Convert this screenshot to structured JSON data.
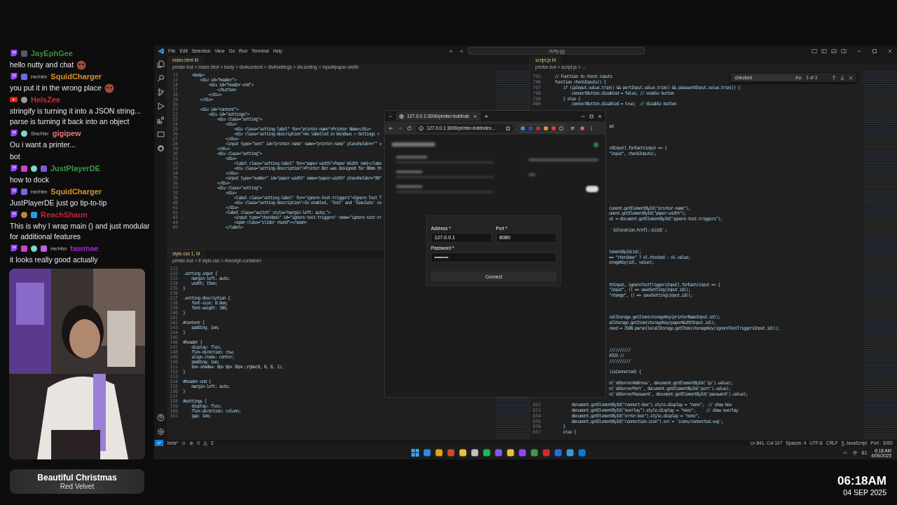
{
  "chat": [
    {
      "kind": "twitch",
      "badges": [
        {
          "kind": "screen"
        }
      ],
      "name": "JayEphGee",
      "color": "#3f8a3f",
      "lines": [
        {
          "text": "hello nutty and chat",
          "emote": true
        }
      ]
    },
    {
      "kind": "twitch",
      "badges": [
        {
          "kind": "flower"
        }
      ],
      "pronoun": "He/Him",
      "name": "SquidCharger",
      "color": "#d9902a",
      "lines": [
        {
          "text": "you put it in the wrong place",
          "emote": true
        }
      ]
    },
    {
      "kind": "youtube",
      "badges": [
        {
          "kind": "verified"
        }
      ],
      "name": "HelsZee",
      "color": "#d42a2a",
      "lines": [
        {
          "text": "stringify is turning it into a JSON string... parse is turning it back into an object",
          "emote": false
        }
      ]
    },
    {
      "kind": "twitch",
      "badges": [
        {
          "kind": "shield"
        }
      ],
      "pronoun": "She/Her",
      "name": "gigipew",
      "color": "#e8737a",
      "lines": [
        {
          "text": "Ou i want a printer...",
          "emote": false
        },
        {
          "text": "bot",
          "emote": false
        }
      ]
    },
    {
      "kind": "twitch",
      "badges": [
        {
          "kind": "gem"
        },
        {
          "kind": "shield"
        },
        {
          "kind": "bars"
        }
      ],
      "name": "JustPlayerDE",
      "color": "#3c9a4a",
      "lines": [
        {
          "text": "how to dock",
          "emote": false
        }
      ]
    },
    {
      "kind": "twitch",
      "badges": [
        {
          "kind": "flower"
        }
      ],
      "pronoun": "He/Him",
      "name": "SquidCharger",
      "color": "#d9902a",
      "lines": [
        {
          "text": "JustPlayerDE just go tip-to-tip",
          "emote": false
        }
      ]
    },
    {
      "kind": "twitch",
      "badges": [
        {
          "kind": "acorn"
        },
        {
          "kind": "crown"
        }
      ],
      "name": "ReachShaun",
      "color": "#c0243c",
      "lines": [
        {
          "text": "This is why I wrap main () and just modular for additional features",
          "emote": false
        }
      ]
    },
    {
      "kind": "twitch",
      "badges": [
        {
          "kind": "gem"
        },
        {
          "kind": "shield"
        },
        {
          "kind": "heart"
        }
      ],
      "pronoun": "He/Him",
      "name": "tawmae",
      "color": "#9a28c8",
      "lines": [
        {
          "text": "it looks really good actually",
          "emote": false
        }
      ]
    }
  ],
  "now_playing": {
    "title": "Beautiful Christmas",
    "artist": "Red Velvet"
  },
  "clock": {
    "time": "06:18AM",
    "date": "04 SEP 2025"
  },
  "vscode": {
    "menu": [
      "File",
      "Edit",
      "Selection",
      "View",
      "Go",
      "Run",
      "Terminal",
      "Help"
    ],
    "search": "nutty.gg",
    "top_pane": {
      "tab": "index.html M",
      "breadcrumb": "printer-bot > index.html > body > div#content > div#settings > div.setting > input#paper-width",
      "lines": [
        {
          "n": "11",
          "text": "    <body>"
        },
        {
          "n": "12",
          "text": "        <div id=\"header\">"
        },
        {
          "n": "14",
          "text": "            <div id=\"header-end\">"
        },
        {
          "n": "17",
          "text": "                </button>"
        },
        {
          "n": "18",
          "text": "            </div>"
        },
        {
          "n": "19",
          "text": "        </div>"
        },
        {
          "n": "20"
        },
        {
          "n": "21",
          "text": "        <div id=\"content\">"
        },
        {
          "n": "22",
          "text": "            <div id=\"settings\">"
        },
        {
          "n": "23",
          "text": "                <div class=\"setting\">"
        },
        {
          "n": "24",
          "text": "                    <div>"
        },
        {
          "n": "25",
          "text": "                        <div class=\"setting-label\" for=\"printer-name\">Printer Name</div>"
        },
        {
          "n": "26",
          "text": "                        <div class=\"setting-description\">As labelled in Windows > Settings >"
        },
        {
          "n": "27",
          "text": "                    </div>"
        },
        {
          "n": "28",
          "text": "                    <input type=\"text\" id=\"printer-name\" name=\"printer-name\" placeholder=\"\" v"
        },
        {
          "n": "29",
          "text": "                </div>"
        },
        {
          "n": "30",
          "text": "                <div class=\"setting\">"
        },
        {
          "n": "31",
          "text": "                    <div>"
        },
        {
          "n": "32",
          "text": "                        <label class=\"setting-label\" for=\"paper-width\">Paper Width (mm)</labe"
        },
        {
          "n": "33",
          "text": "                        <div class=\"setting-description\">Printer Bot was designed for 80mm th"
        },
        {
          "n": "34",
          "text": "                    </div>"
        },
        {
          "n": "35",
          "text": "                    <input type=\"number\" id=\"paper-width\" name=\"paper-width\" placeholder=\"80\""
        },
        {
          "n": "36",
          "text": "                </div>"
        },
        {
          "n": "37",
          "text": "                <div class=\"setting\">"
        },
        {
          "n": "38",
          "text": "                    <div>"
        },
        {
          "n": "39",
          "text": "                        <label class=\"setting-label\" for=\"ignore-test-triggers\">Ignore Test T"
        },
        {
          "n": "40",
          "text": "                        <div class=\"setting-description\">In enabled, 'Test' and 'Simulate' ev"
        },
        {
          "n": "41",
          "text": "                    </div>"
        },
        {
          "n": "42",
          "text": "                    <label class=\"switch\" style=\"margin-left: auto;\">"
        },
        {
          "n": "43",
          "text": "                        <input type=\"checkbox\" id=\"ignore-test-triggers\" name=\"ignore-test-tr"
        },
        {
          "n": "44",
          "text": "                        <span class=\"slider round\"></span>"
        },
        {
          "n": "45",
          "text": "                    </label>"
        }
      ]
    },
    "bottom_pane": {
      "tab": "style.css 1, M",
      "breadcrumb": "printer-bot > # style.css > #receipt-container",
      "lines": [
        {
          "n": "131"
        },
        {
          "n": "132",
          "text": ".setting input {"
        },
        {
          "n": "133",
          "text": "    margin-left: auto;"
        },
        {
          "n": "134",
          "text": "    width: 15em;"
        },
        {
          "n": "135",
          "text": "}"
        },
        {
          "n": "136"
        },
        {
          "n": "137",
          "text": ".setting-description {"
        },
        {
          "n": "138",
          "text": "    font-size: 0.9em;"
        },
        {
          "n": "139",
          "text": "    font-weight: 100;"
        },
        {
          "n": "140",
          "text": "}"
        },
        {
          "n": "141"
        },
        {
          "n": "142",
          "text": "#content {"
        },
        {
          "n": "143",
          "text": "    padding: 1em;"
        },
        {
          "n": "144",
          "text": "}"
        },
        {
          "n": "145"
        },
        {
          "n": "146",
          "text": "#header {"
        },
        {
          "n": "147",
          "text": "    display: flex;"
        },
        {
          "n": "148",
          "text": "    flex-direction: row;"
        },
        {
          "n": "149",
          "text": "    align-items: center;"
        },
        {
          "n": "150",
          "text": "    padding: 1em;"
        },
        {
          "n": "151",
          "text": "    box-shadow: 0px 0px 10px ▢rgba(0, 0, 0, 1);"
        },
        {
          "n": "152",
          "text": "}"
        },
        {
          "n": "153"
        },
        {
          "n": "154",
          "text": "#header-end {"
        },
        {
          "n": "155",
          "text": "    margin-left: auto;"
        },
        {
          "n": "156",
          "text": "}"
        },
        {
          "n": "157"
        },
        {
          "n": "158",
          "text": "#settings {"
        },
        {
          "n": "159",
          "text": "    display: flex;"
        },
        {
          "n": "160",
          "text": "    flex-direction: column;"
        },
        {
          "n": "161",
          "text": "    gap: 1em;"
        }
      ]
    },
    "right_pane": {
      "tab": "script.js M",
      "breadcrumb": "printer-bot > script.js > ...",
      "find": {
        "query": "checked",
        "case": "Aa",
        "count": "3 of 3"
      },
      "top_lines": [
        {
          "n": "795",
          "text": "    // Function to check inputs"
        },
        {
          "n": "796",
          "text": "    function checkInputs() {"
        },
        {
          "n": "797",
          "text": "        if (ipInput.value.trim() && portInput.value.trim() && passwordInput.value.trim()) {"
        },
        {
          "n": "798",
          "text": "            connectButton.disabled = false; // enable button"
        },
        {
          "n": "799",
          "text": "        } else {"
        },
        {
          "n": "800",
          "text": "            connectButton.disabled = true;  // disable button"
        }
      ],
      "fragments": [
        "ad",
        "rdInput].forEach(input => {",
        "\"input\", checkInputs);",
        "cument.getElementById(\"printer-name\");",
        "ument.getElementById(\"paper-width\");",
        "ut = document.getElementById(\"ignore-test-triggers\");",
        " `${location.href}::${id}`;",
        "lementById(id);",
        "== \"checkbox\" ? el.checked : el.value;",
        "orageKey(id), value);",
        "thInput, ignoreTestTriggersInput].forEach(input => {",
        "\"input\", () => saveSetting(input.id));",
        "\"change\", () => saveSetting(input.id));",
        "calStorage.getItem(storageKey(printerNameInput.id));",
        "alStorage.getItem(storageKey(paperWidthInput.id));",
        "cked = JSON.parse(localStorage.getItem(storageKey(ignoreTestTriggersInput.id)));",
        "//////////",
        "ATUS //",
        "//////////",
        "(isConnected) {",
        "n('sbServerAddress', document.getElementById('ip').value);",
        "n('sbServerPort', document.getElementById('port').value);",
        "n('sbServerPassword', document.getElementById('password').value);"
      ],
      "bottom_lines": [
        {
          "n": "852",
          "text": "            document.getElementById(\"connect-box\").style.display = \"none\";  // show box"
        },
        {
          "n": "853",
          "text": "            document.getElementById(\"overlay\").style.display = \"none\";     // show overlay"
        },
        {
          "n": "854",
          "text": "            document.getElementById(\"error-box\").style.display = \"none\";"
        },
        {
          "n": "855",
          "text": "            document.getElementById(\"connection-icon\").src = 'icons/connected.svg';"
        },
        {
          "n": "856",
          "text": "        }"
        },
        {
          "n": "857",
          "text": "        else {"
        }
      ]
    },
    "status_left": {
      "branch": "beta*",
      "errors": "0",
      "warnings": "3"
    },
    "status_right": [
      "Ln 841, Col 107",
      "Spaces: 4",
      "UTF-8",
      "CRLF",
      "{} JavaScript",
      "Port : 3000"
    ],
    "taskbar": {
      "battery": "61",
      "time": "6:18 AM",
      "date": "4/09/2025"
    }
  },
  "browser": {
    "toggle": {
      "on": true
    },
    "tab": "127.0.0.1:3000/printer-bot/inde",
    "url": "127.0.0.1:3000/printer-bot/index...",
    "form": {
      "fields": [
        {
          "label": "Address *",
          "value": "127.0.0.1"
        },
        {
          "label": "Port *",
          "value": "8080"
        },
        {
          "label": "Password *",
          "value": "••••••••"
        }
      ],
      "button": "Connect"
    }
  }
}
